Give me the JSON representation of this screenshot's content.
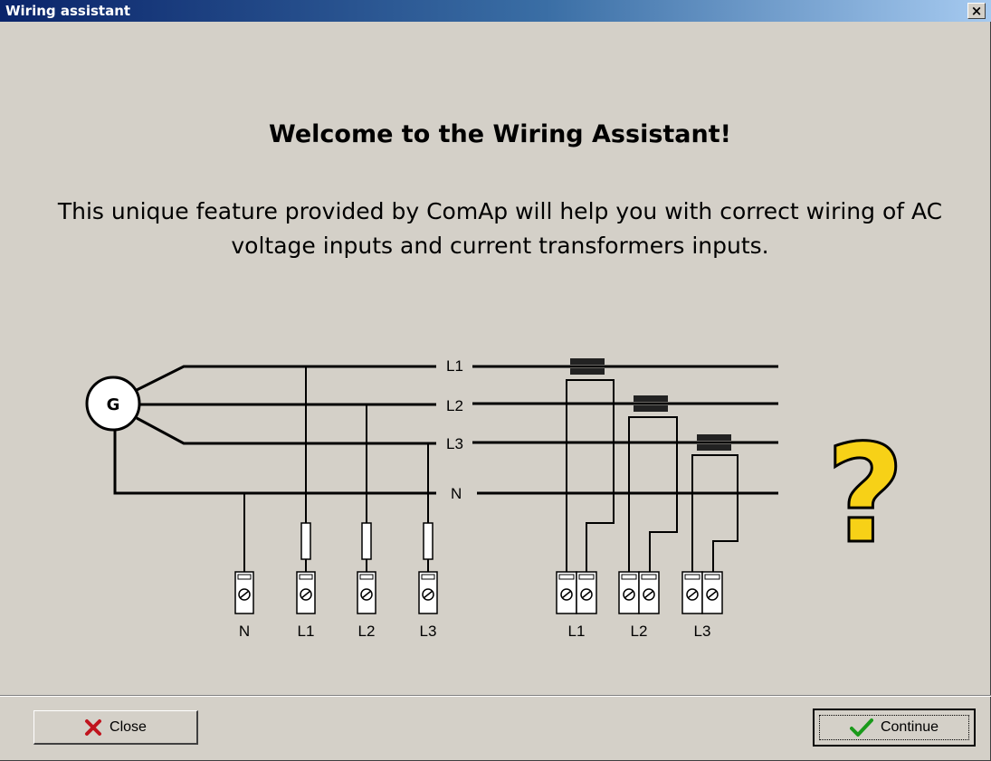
{
  "window": {
    "title": "Wiring assistant",
    "close_glyph": "×"
  },
  "content": {
    "heading": "Welcome to the Wiring Assistant!",
    "intro": "This unique feature provided by ComAp will help you with correct wiring of AC voltage inputs and current transformers inputs."
  },
  "diagram": {
    "generator_label": "G",
    "line_labels": [
      "L1",
      "L2",
      "L3",
      "N"
    ],
    "voltage_terminal_labels": [
      "N",
      "L1",
      "L2",
      "L3"
    ],
    "ct_terminal_labels": [
      "L1",
      "L2",
      "L3"
    ],
    "question_mark": "?"
  },
  "buttons": {
    "close_label": "Close",
    "close_icon": "red-x-icon",
    "continue_label": "Continue",
    "continue_icon": "green-check-icon"
  },
  "colors": {
    "title_gradient_start": "#0a246a",
    "title_gradient_end": "#a6caf0",
    "question_mark_fill": "#f7d117"
  }
}
